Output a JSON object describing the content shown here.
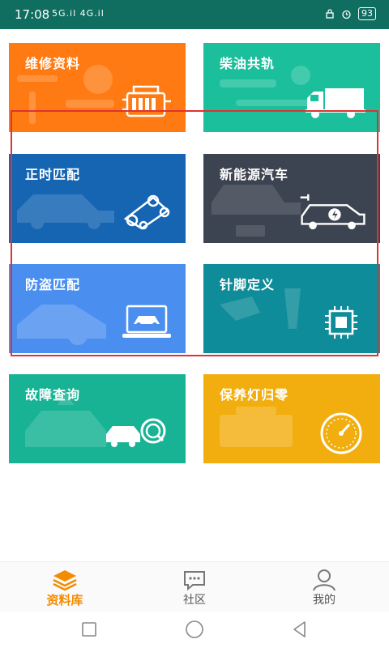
{
  "status_bar": {
    "time": "17:08",
    "signal_text": "5G.il 4G.il",
    "battery": "93"
  },
  "tiles": [
    {
      "label": "维修资料",
      "color": "#ff7a12",
      "icon": "engine-icon"
    },
    {
      "label": "柴油共轨",
      "color": "#1bbf9b",
      "icon": "truck-icon"
    },
    {
      "label": "正时匹配",
      "color": "#1565b3",
      "icon": "timing-belt-icon"
    },
    {
      "label": "新能源汽车",
      "color": "#3d4451",
      "icon": "electric-car-icon"
    },
    {
      "label": "防盗匹配",
      "color": "#4a8ff0",
      "icon": "laptop-car-icon"
    },
    {
      "label": "针脚定义",
      "color": "#0f8c99",
      "icon": "chip-icon"
    },
    {
      "label": "故障查询",
      "color": "#18b394",
      "icon": "car-search-icon"
    },
    {
      "label": "保养灯归零",
      "color": "#f2ae0e",
      "icon": "gauge-icon"
    }
  ],
  "tabbar": {
    "items": [
      {
        "label": "资料库",
        "icon": "layers-icon",
        "active": true
      },
      {
        "label": "社区",
        "icon": "chat-icon",
        "active": false
      },
      {
        "label": "我的",
        "icon": "user-icon",
        "active": false
      }
    ]
  },
  "colors": {
    "status_bar": "#0f6e5f",
    "highlight": "#dd3333",
    "tab_active": "#f28c00"
  }
}
